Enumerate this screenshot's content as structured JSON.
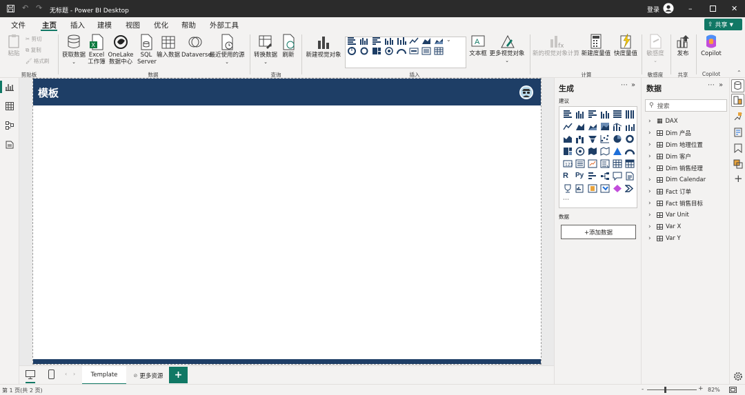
{
  "titlebar": {
    "doc_title": "无标题 - Power BI Desktop",
    "signin": "登录"
  },
  "menu": {
    "items": [
      "文件",
      "主页",
      "插入",
      "建模",
      "视图",
      "优化",
      "帮助",
      "外部工具"
    ],
    "active": "主页",
    "share": "共享"
  },
  "ribbon": {
    "paste": "粘贴",
    "cut": "剪切",
    "copy": "复制",
    "format_painter": "格式刷",
    "get_data": "获取数据",
    "excel": "Excel 工作簿",
    "onelake": "OneLake 数据中心",
    "sql": "SQL Server",
    "enter_data": "输入数据",
    "dataverse": "Dataverse",
    "recent_sources": "最近使用的源",
    "transform": "转换数据",
    "refresh": "刷新",
    "new_visual": "新建视觉对象",
    "textbox": "文本框",
    "more_visuals": "更多视觉对象",
    "new_visual_calc": "新的视觉对象计算",
    "new_measure": "新建度量值",
    "quick_measure": "快度量值",
    "sensitivity": "敏感度",
    "publish": "发布",
    "copilot": "Copilot",
    "groups": {
      "clipboard": "剪贴板",
      "data": "数据",
      "query": "查询",
      "insert": "插入",
      "calc": "计算",
      "sensitivity": "敏感度",
      "share": "共享",
      "copilot": "Copilot"
    }
  },
  "canvas": {
    "header_title": "模板"
  },
  "pages": {
    "tabs": [
      "Template",
      "更多资源"
    ],
    "add": "+"
  },
  "status": {
    "page_info": "第 1 页(共 2 页)",
    "zoom": "82%"
  },
  "build_pane": {
    "title": "生成",
    "suggest": "建议",
    "data_label": "数据",
    "add_data": "+添加数据"
  },
  "data_pane": {
    "title": "数据",
    "search_placeholder": "搜索",
    "tables": [
      "DAX",
      "Dim 产品",
      "Dim 地理位置",
      "Dim 客户",
      "Dim 销售经理",
      "Dim Calendar",
      "Fact 订单",
      "Fact 销售目标",
      "Var Unit",
      "Var X",
      "Var Y"
    ]
  },
  "colors": {
    "accent": "#117865",
    "header": "#1e3e66",
    "titlebar": "#2b2b2b"
  }
}
